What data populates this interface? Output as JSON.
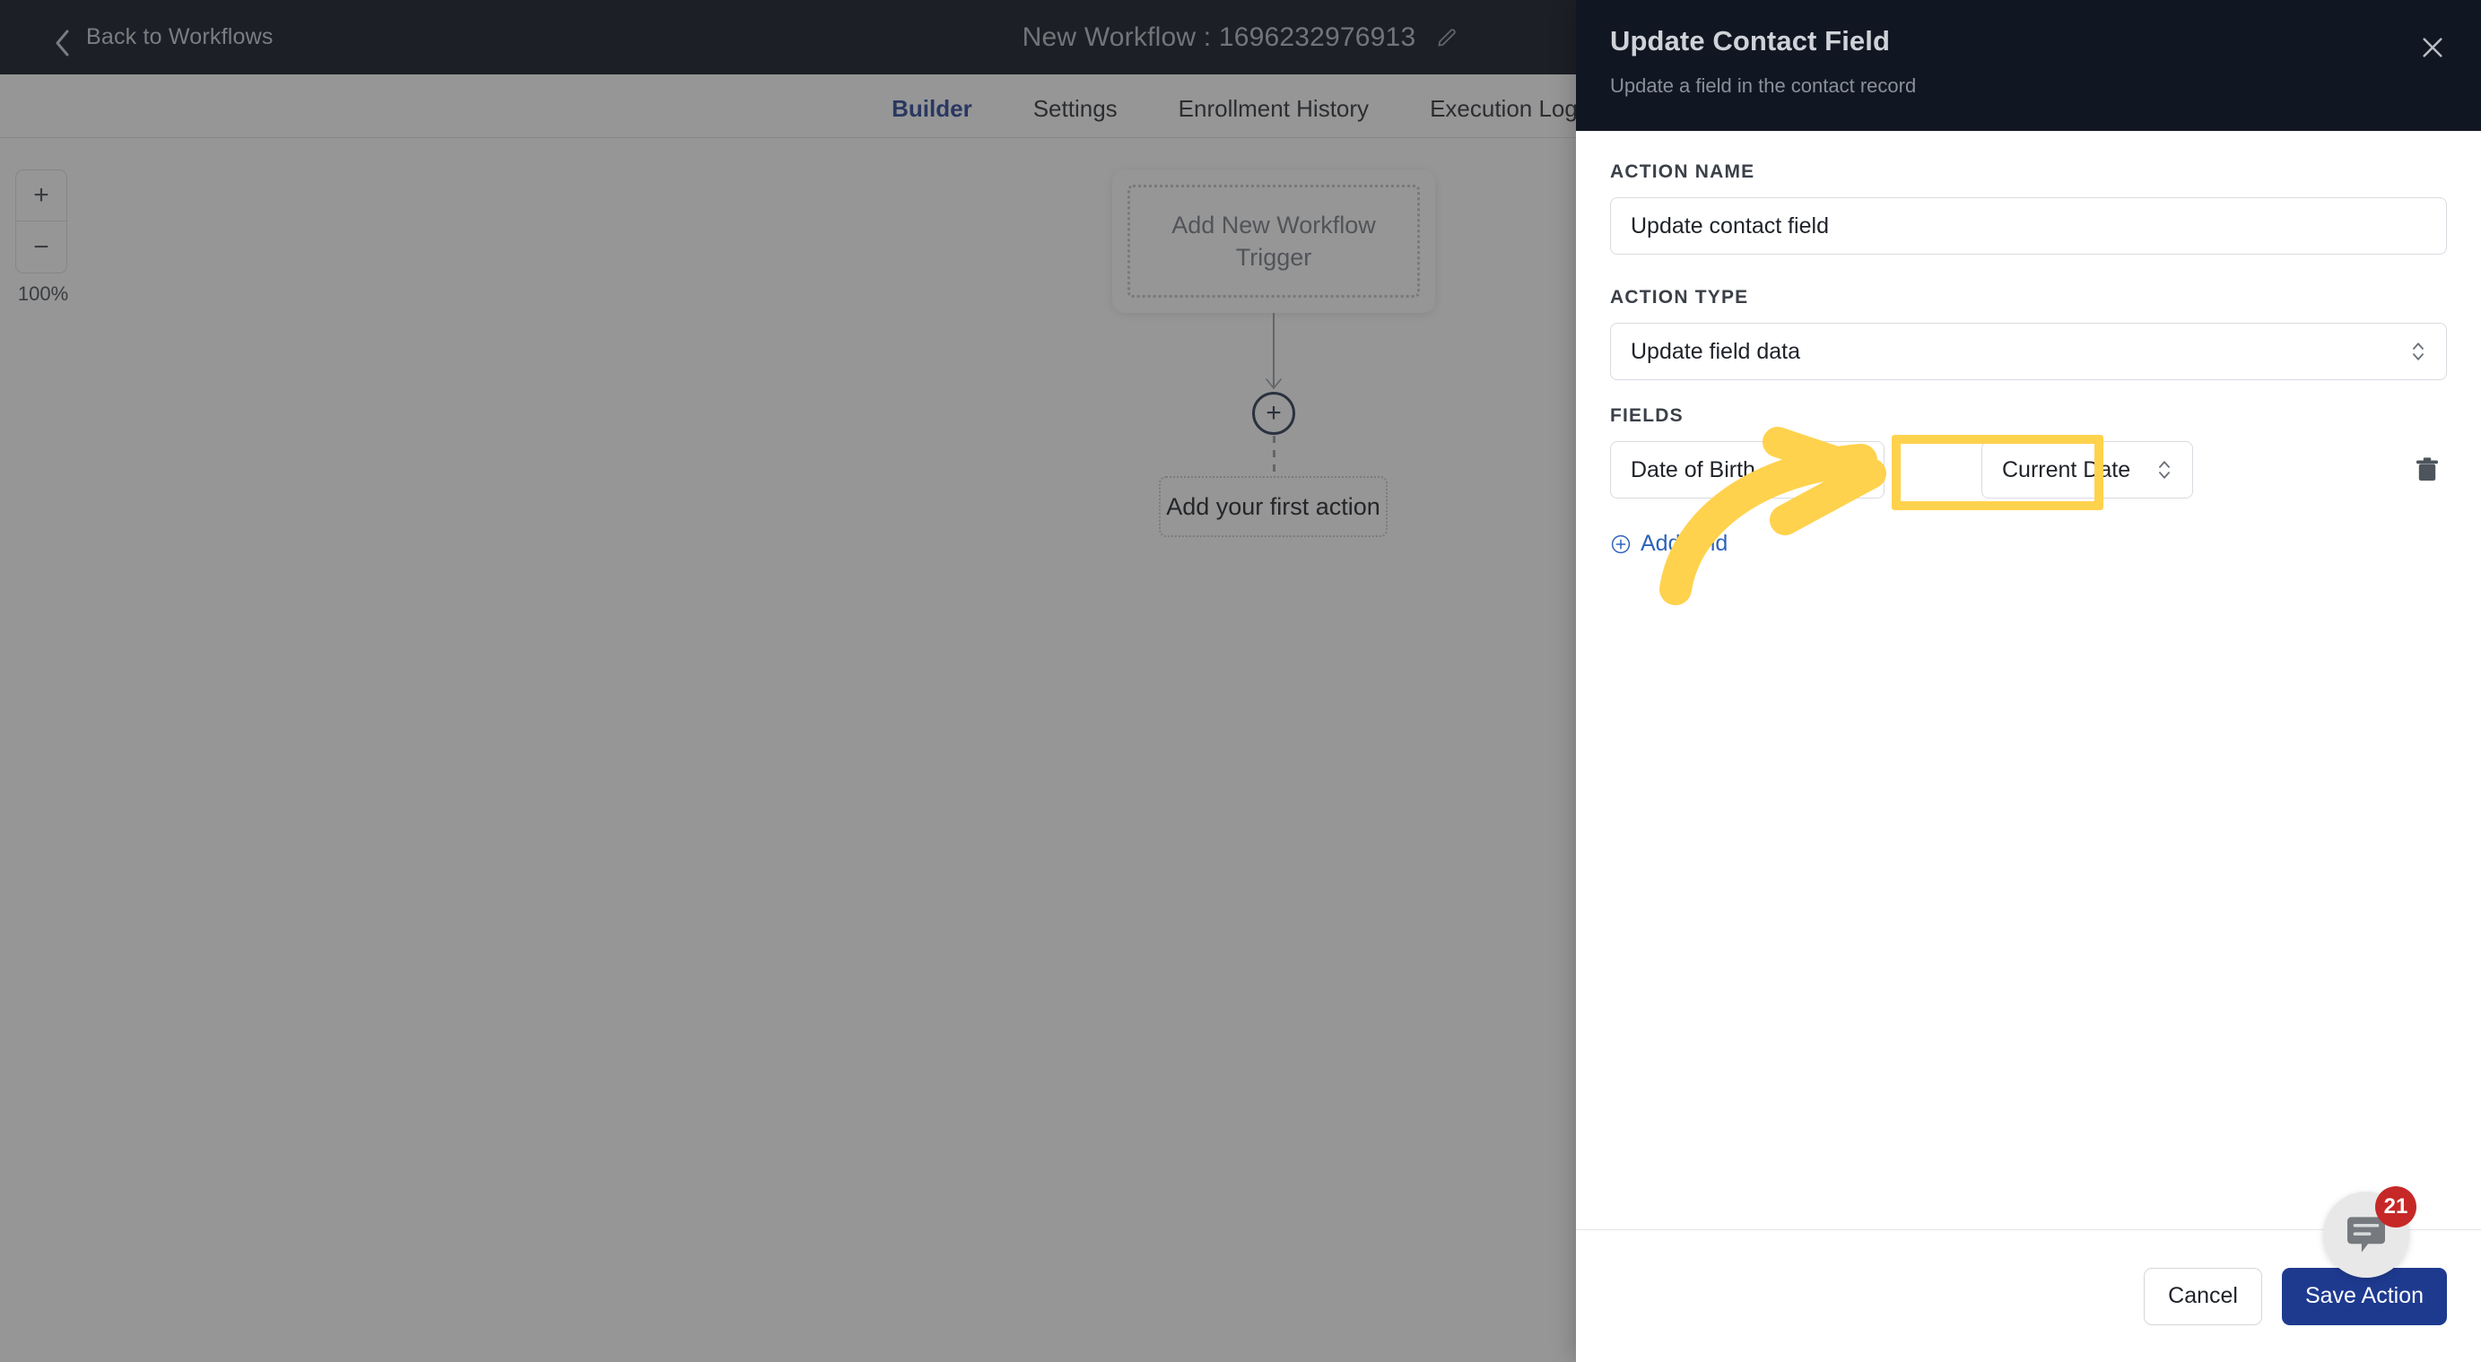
{
  "topbar": {
    "back_label": "Back to Workflows",
    "back_icon": "chevron-left-icon",
    "workflow_title": "New Workflow : 1696232976913",
    "edit_icon": "pencil-icon"
  },
  "tabs": [
    {
      "label": "Builder",
      "active": true
    },
    {
      "label": "Settings",
      "active": false
    },
    {
      "label": "Enrollment History",
      "active": false
    },
    {
      "label": "Execution Logs",
      "active": false
    }
  ],
  "canvas": {
    "zoom": {
      "zoom_in_label": "+",
      "zoom_out_label": "−",
      "level": "100%"
    },
    "trigger_card_label": "Add New Workflow Trigger",
    "add_node_label": "+",
    "first_action_label": "Add your first action"
  },
  "panel": {
    "title": "Update Contact Field",
    "subtitle": "Update a field in the contact record",
    "close_icon": "close-icon",
    "action_name": {
      "label": "ACTION NAME",
      "value": "Update contact field",
      "placeholder": "Action name"
    },
    "action_type": {
      "label": "ACTION TYPE",
      "value": "Update field data",
      "caret_icon": "chevron-updown-icon"
    },
    "fields": {
      "label": "FIELDS",
      "rows": [
        {
          "field_name": "Date of Birth",
          "field_value": "Current Date",
          "delete_icon": "trash-icon",
          "highlighted": true
        }
      ],
      "add_field_label": "Add field",
      "add_field_icon": "plus-circle-icon"
    },
    "footer": {
      "cancel_label": "Cancel",
      "save_label": "Save Action"
    }
  },
  "chat_widget": {
    "icon": "chat-bubble-icon",
    "badge_count": "21"
  },
  "annotation": {
    "arrow_icon": "curved-arrow-right-icon",
    "highlight_color": "#ffd24d"
  }
}
